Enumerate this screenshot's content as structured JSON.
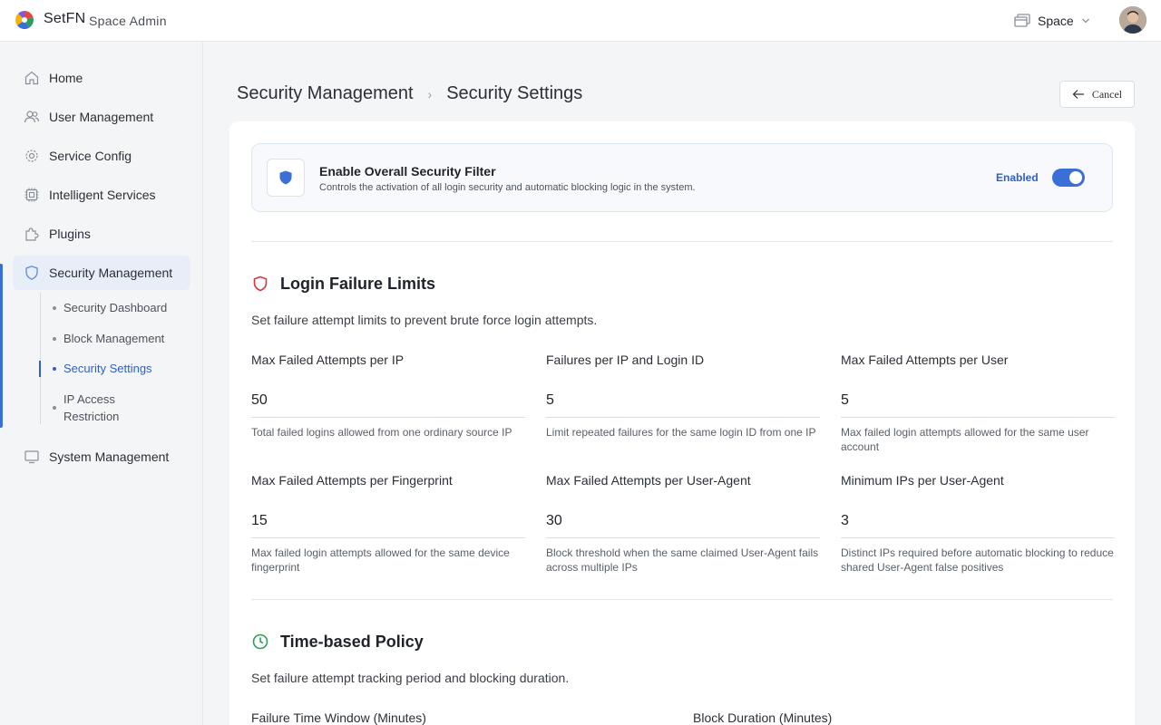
{
  "topbar": {
    "brand": "SetFN",
    "subtitle": "Space Admin",
    "space_label": "Space"
  },
  "sidebar": {
    "items": [
      {
        "label": "Home"
      },
      {
        "label": "User Management"
      },
      {
        "label": "Service Config"
      },
      {
        "label": "Intelligent Services"
      },
      {
        "label": "Plugins"
      },
      {
        "label": "Security Management"
      },
      {
        "label": "System Management"
      }
    ],
    "security_subitems": [
      {
        "label": "Security Dashboard"
      },
      {
        "label": "Block Management"
      },
      {
        "label": "Security Settings"
      },
      {
        "label": "IP Access Restriction"
      }
    ]
  },
  "breadcrumb": {
    "parent": "Security Management",
    "current": "Security Settings"
  },
  "cancel_label": "Cancel",
  "filter": {
    "title": "Enable Overall Security Filter",
    "description": "Controls the activation of all login security and automatic blocking logic in the system.",
    "status": "Enabled"
  },
  "login_limits": {
    "title": "Login Failure Limits",
    "description": "Set failure attempt limits to prevent brute force login attempts.",
    "fields": [
      {
        "label": "Max Failed Attempts per IP",
        "value": "50",
        "help": "Total failed logins allowed from one ordinary source IP"
      },
      {
        "label": "Failures per IP and Login ID",
        "value": "5",
        "help": "Limit repeated failures for the same login ID from one IP"
      },
      {
        "label": "Max Failed Attempts per User",
        "value": "5",
        "help": "Max failed login attempts allowed for the same user account"
      },
      {
        "label": "Max Failed Attempts per Fingerprint",
        "value": "15",
        "help": "Max failed login attempts allowed for the same device fingerprint"
      },
      {
        "label": "Max Failed Attempts per User-Agent",
        "value": "30",
        "help": "Block threshold when the same claimed User-Agent fails across multiple IPs"
      },
      {
        "label": "Minimum IPs per User-Agent",
        "value": "3",
        "help": "Distinct IPs required before automatic blocking to reduce shared User-Agent false positives"
      }
    ]
  },
  "time_policy": {
    "title": "Time-based Policy",
    "description": "Set failure attempt tracking period and blocking duration.",
    "fields": [
      {
        "label": "Failure Time Window (Minutes)"
      },
      {
        "label": "Block Duration (Minutes)"
      }
    ]
  },
  "colors": {
    "accent": "#3b6fd8",
    "danger": "#d9363e",
    "success": "#2e9d5b"
  }
}
